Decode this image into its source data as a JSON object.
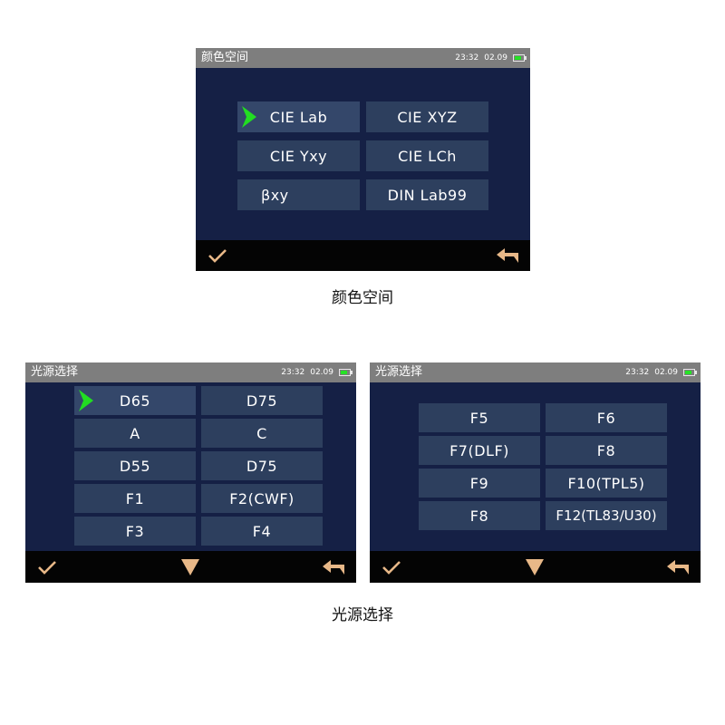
{
  "screens": [
    {
      "title": "颜色空间",
      "time": "23:32",
      "date": "02.09",
      "battery_level": 0.7,
      "options": [
        "CIE Lab",
        "CIE XYZ",
        "CIE Yxy",
        "CIE LCh",
        "βxy",
        "DIN Lab99"
      ],
      "selected": "CIE Lab",
      "footer_icons": [
        "checkmark-icon",
        "back-arrow-icon"
      ],
      "caption": "颜色空间"
    },
    {
      "title": "光源选择",
      "time": "23:32",
      "date": "02.09",
      "battery_level": 0.7,
      "options": [
        "D65",
        "D75",
        "A",
        "C",
        "D55",
        "D75",
        "F1",
        "F2(CWF)",
        "F3",
        "F4"
      ],
      "selected": "D65",
      "footer_icons": [
        "checkmark-icon",
        "down-triangle-icon",
        "back-arrow-icon"
      ]
    },
    {
      "title": "光源选择",
      "time": "23:32",
      "date": "02.09",
      "battery_level": 0.7,
      "options": [
        "F5",
        "F6",
        "F7(DLF)",
        "F8",
        "F9",
        "F10(TPL5)",
        "F8",
        "F12(TL83/U30)"
      ],
      "footer_icons": [
        "checkmark-icon",
        "down-triangle-icon",
        "back-arrow-icon"
      ]
    }
  ],
  "caption_bottom": "光源选择",
  "colors": {
    "screen_bg": "#152045",
    "titlebar": "#7e7e7e",
    "option_bg": "#2d3f5e",
    "footer": "#040404",
    "accent_icon": "#e8b888",
    "selection_arrow": "#22dd22",
    "battery": "#26e226"
  }
}
